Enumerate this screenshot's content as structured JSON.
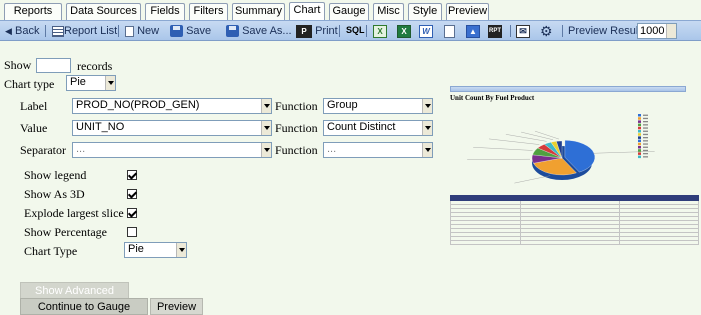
{
  "tabs": [
    {
      "label": "Reports",
      "active": false
    },
    {
      "label": "Data Sources",
      "active": false
    },
    {
      "label": "Fields",
      "active": false
    },
    {
      "label": "Filters",
      "active": false
    },
    {
      "label": "Summary",
      "active": false
    },
    {
      "label": "Chart",
      "active": true
    },
    {
      "label": "Gauge",
      "active": false
    },
    {
      "label": "Misc",
      "active": false
    },
    {
      "label": "Style",
      "active": false
    },
    {
      "label": "Preview",
      "active": false
    }
  ],
  "toolbar": {
    "back": "Back",
    "report_list": "Report List",
    "new": "New",
    "save": "Save",
    "save_as": "Save As...",
    "print": "Print",
    "sql_icon_text": "SQL",
    "preview_results_label": "Preview Results",
    "preview_results_value": "1000",
    "icons": [
      "pdf-icon",
      "sql-icon",
      "excel-icon",
      "excel-icon",
      "word-icon",
      "text-file-icon",
      "image-icon",
      "report-icon",
      "email-icon",
      "gear-icon"
    ]
  },
  "form": {
    "show_label": "Show",
    "show_value": "",
    "records_label": "records",
    "chart_type_label": "Chart type",
    "chart_type_value": "Pie",
    "label_label": "Label",
    "label_value": "PROD_NO(PROD_GEN)",
    "label_function_label": "Function",
    "label_function_value": "Group",
    "value_label": "Value",
    "value_value": "UNIT_NO",
    "value_function_label": "Function",
    "value_function_value": "Count Distinct",
    "separator_label": "Separator",
    "separator_value": "...",
    "separator_function_label": "Function",
    "separator_function_value": "...",
    "show_legend_label": "Show legend",
    "show_legend": true,
    "show_3d_label": "Show As 3D",
    "show_3d": true,
    "explode_label": "Explode largest slice",
    "explode": true,
    "show_percentage_label": "Show Percentage",
    "show_percentage": false,
    "chart_type2_label": "Chart Type",
    "chart_type2_value": "Pie"
  },
  "buttons": {
    "show_advanced": "Show Advanced",
    "continue": "Continue to Gauge",
    "preview": "Preview"
  },
  "thumbnail": {
    "title": "Unit Count By Fuel Product",
    "colors": [
      "#2e6fd6",
      "#f0a030",
      "#7a2f8c",
      "#50a040",
      "#d43b3b",
      "#3fb8c8",
      "#e8d030",
      "#1f3f8f"
    ]
  }
}
